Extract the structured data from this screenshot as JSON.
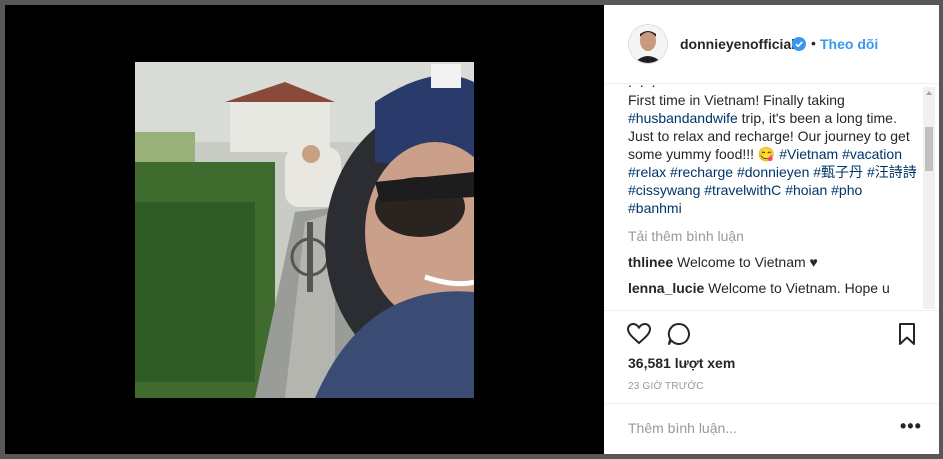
{
  "post": {
    "username": "donnieyenofficial",
    "follow_label": "Theo dõi",
    "separator": "•",
    "caption_ellipsis": ". . .",
    "caption_parts": [
      {
        "text": "First time in Vietnam! Finally taking ",
        "tag": false
      },
      {
        "text": "#husbandandwife",
        "tag": true
      },
      {
        "text": " trip, it's been a long time. Just to relax and recharge! Our journey to get some yummy food!!! 😋 ",
        "tag": false
      },
      {
        "text": "#Vietnam",
        "tag": true
      },
      {
        "text": " ",
        "tag": false
      },
      {
        "text": "#vacation",
        "tag": true
      },
      {
        "text": " ",
        "tag": false
      },
      {
        "text": "#relax",
        "tag": true
      },
      {
        "text": " ",
        "tag": false
      },
      {
        "text": "#recharge",
        "tag": true
      },
      {
        "text": " ",
        "tag": false
      },
      {
        "text": "#donnieyen",
        "tag": true
      },
      {
        "text": " ",
        "tag": false
      },
      {
        "text": "#甄子丹",
        "tag": true
      },
      {
        "text": " ",
        "tag": false
      },
      {
        "text": "#汪詩詩",
        "tag": true
      },
      {
        "text": " ",
        "tag": false
      },
      {
        "text": "#cissywang",
        "tag": true
      },
      {
        "text": " ",
        "tag": false
      },
      {
        "text": "#travelwithC",
        "tag": true
      },
      {
        "text": " ",
        "tag": false
      },
      {
        "text": "#hoian",
        "tag": true
      },
      {
        "text": " ",
        "tag": false
      },
      {
        "text": "#pho",
        "tag": true
      },
      {
        "text": " ",
        "tag": false
      },
      {
        "text": "#banhmi",
        "tag": true
      }
    ],
    "load_more_label": "Tải thêm bình luận",
    "comments": [
      {
        "user": "thlinee",
        "text": "Welcome to Vietnam ♥"
      },
      {
        "user": "lenna_lucie",
        "text": "Welcome to Vietnam. Hope u"
      }
    ],
    "views_count": "36,581",
    "views_label": "lượt xem",
    "timestamp": "23 GIỜ TRƯỚC",
    "comment_placeholder": "Thêm bình luận...",
    "more_options": "•••"
  },
  "colors": {
    "link_blue": "#3897f0",
    "hashtag": "#003569",
    "muted": "#999999"
  },
  "icons": [
    "verified-badge-icon",
    "heart-icon",
    "comment-icon",
    "bookmark-icon",
    "scroll-up-arrow-icon",
    "more-options-icon"
  ]
}
